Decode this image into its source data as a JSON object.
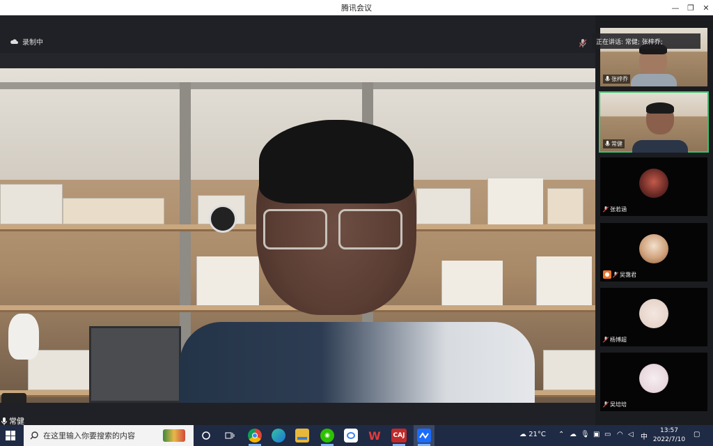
{
  "window": {
    "title": "腾讯会议"
  },
  "header": {
    "recording_label": "录制中",
    "speaking_text": "正在讲话: 常健; 张梓乔;"
  },
  "main_video": {
    "speaker_name": "常健"
  },
  "participants": [
    {
      "name": "张梓乔",
      "type": "video"
    },
    {
      "name": "常健",
      "type": "video",
      "active": true
    },
    {
      "name": "张若涵",
      "type": "avatar"
    },
    {
      "name": "吴霭君",
      "type": "avatar",
      "host_badge": true
    },
    {
      "name": "杨博超",
      "type": "avatar"
    },
    {
      "name": "吴培培",
      "type": "avatar"
    }
  ],
  "taskbar": {
    "search_placeholder": "在这里输入你要搜索的内容",
    "apps": [
      {
        "icon": "cortana-circle-icon"
      },
      {
        "icon": "task-view-icon"
      },
      {
        "icon": "chrome-icon"
      },
      {
        "icon": "edge-icon"
      },
      {
        "icon": "file-explorer-icon"
      },
      {
        "icon": "wechat-icon"
      },
      {
        "icon": "baidu-netdisk-icon"
      },
      {
        "icon": "wps-icon"
      },
      {
        "label": "CAJ",
        "icon": "caj-viewer-icon"
      },
      {
        "icon": "tencent-meeting-icon"
      }
    ],
    "weather": "21°C",
    "ime": "中",
    "time": "13:57",
    "date": "2022/7/10"
  }
}
